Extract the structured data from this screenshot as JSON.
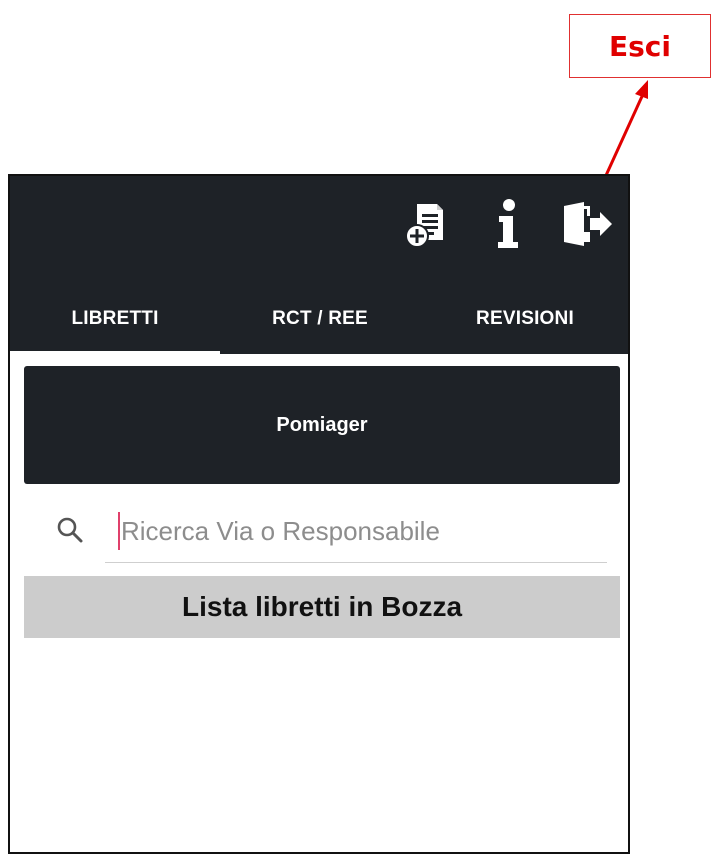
{
  "callout": {
    "label": "Esci"
  },
  "toolbar": {
    "icons": [
      "add-document-icon",
      "info-icon",
      "exit-icon"
    ]
  },
  "tabs": [
    {
      "label": "LIBRETTI",
      "selected": true
    },
    {
      "label": "RCT / REE",
      "selected": false
    },
    {
      "label": "REVISIONI",
      "selected": false
    }
  ],
  "account": {
    "name": "Pomiager"
  },
  "search": {
    "placeholder": "Ricerca Via o Responsabile",
    "value": ""
  },
  "list": {
    "title": "Lista libretti in Bozza"
  },
  "colors": {
    "app_bar": "#1e2227",
    "annotation": "#e00000",
    "banner": "#cccccc",
    "cursor": "#e0406b"
  }
}
